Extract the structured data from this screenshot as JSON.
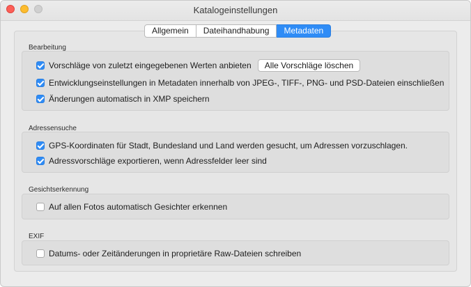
{
  "window": {
    "title": "Katalogeinstellungen"
  },
  "tabs": [
    {
      "label": "Allgemein",
      "active": false
    },
    {
      "label": "Dateihandhabung",
      "active": false
    },
    {
      "label": "Metadaten",
      "active": true
    }
  ],
  "sections": {
    "bearbeitung": {
      "label": "Bearbeitung",
      "items": [
        {
          "label": "Vorschläge von zuletzt eingegebenen Werten anbieten",
          "checked": true
        },
        {
          "label": "Entwicklungseinstellungen in Metadaten innerhalb von JPEG-, TIFF-, PNG- und PSD-Dateien einschließen",
          "checked": true
        },
        {
          "label": "Änderungen automatisch in XMP speichern",
          "checked": true
        }
      ],
      "clear_button": "Alle Vorschläge löschen"
    },
    "adressensuche": {
      "label": "Adressensuche",
      "items": [
        {
          "label": "GPS-Koordinaten für Stadt, Bundesland und Land werden gesucht, um Adressen vorzuschlagen.",
          "checked": true
        },
        {
          "label": "Adressvorschläge exportieren, wenn Adressfelder leer sind",
          "checked": true
        }
      ]
    },
    "gesichtserkennung": {
      "label": "Gesichtserkennung",
      "items": [
        {
          "label": "Auf allen Fotos automatisch Gesichter erkennen",
          "checked": false
        }
      ]
    },
    "exif": {
      "label": "EXIF",
      "items": [
        {
          "label": "Datums- oder Zeitänderungen in proprietäre Raw-Dateien schreiben",
          "checked": false
        }
      ]
    }
  },
  "colors": {
    "accent": "#2f8cf6"
  }
}
